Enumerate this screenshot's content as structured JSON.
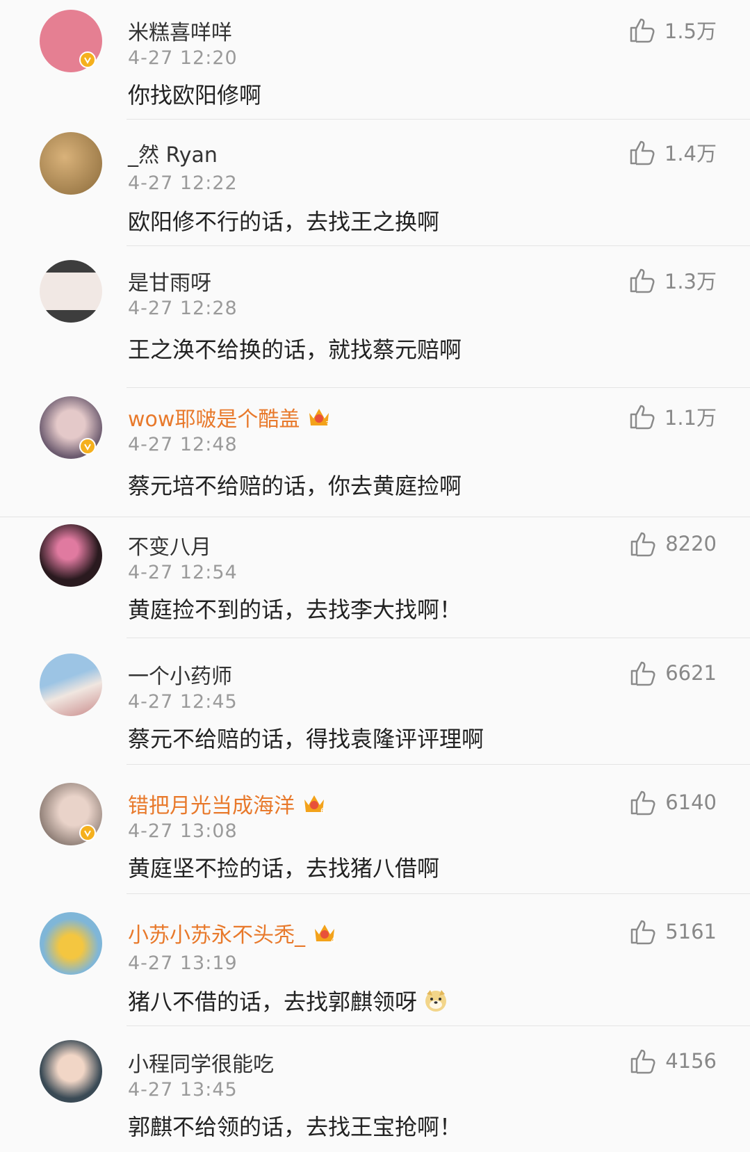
{
  "comments": [
    {
      "name": "米糕喜咩咩",
      "time": "4-27 12:20",
      "text": "你找欧阳修啊",
      "likes": "1.5万",
      "vip": false,
      "verified": true,
      "avatar_color": "#e57f92"
    },
    {
      "name": "_然 Ryan",
      "time": "4-27 12:22",
      "text": "欧阳修不行的话，去找王之换啊",
      "likes": "1.4万",
      "vip": false,
      "verified": false,
      "avatar_color": "#b08a55"
    },
    {
      "name": "是甘雨呀",
      "time": "4-27 12:28",
      "text": "王之涣不给换的话，就找蔡元赔啊",
      "likes": "1.3万",
      "vip": false,
      "verified": false,
      "avatar_color": "#3d3d3d"
    },
    {
      "name": "wow耶啵是个酷盖",
      "time": "4-27 12:48",
      "text": "蔡元培不给赔的话，你去黄庭捡啊",
      "likes": "1.1万",
      "vip": true,
      "crown_level": "3",
      "verified": true,
      "avatar_color": "#6b5a6e"
    },
    {
      "name": "不变八月",
      "time": "4-27 12:54",
      "text": "黄庭捡不到的话，去找李大找啊！",
      "likes": "8220",
      "vip": false,
      "verified": false,
      "avatar_color": "#2a1a1f"
    },
    {
      "name": "一个小药师",
      "time": "4-27 12:45",
      "text": "蔡元不给赔的话，得找袁隆评评理啊",
      "likes": "6621",
      "vip": false,
      "verified": false,
      "avatar_color": "#9cc4e4"
    },
    {
      "name": "错把月光当成海洋",
      "time": "4-27 13:08",
      "text": "黄庭坚不捡的话，去找猪八借啊",
      "likes": "6140",
      "vip": true,
      "crown_level": "6",
      "verified": true,
      "avatar_color": "#8a7a72"
    },
    {
      "name": "小苏小苏永不头秃_",
      "time": "4-27 13:19",
      "text": "猪八不借的话，去找郭麒领呀",
      "likes": "5161",
      "vip": true,
      "crown_level": "4",
      "verified": false,
      "avatar_color": "#7fb6d8"
    },
    {
      "name": "小程同学很能吃",
      "time": "4-27 13:45",
      "text": "郭麒不给领的话，去找王宝抢啊！",
      "likes": "4156",
      "vip": false,
      "verified": false,
      "avatar_color": "#3a4a55"
    }
  ],
  "icons": {
    "like": "thumbs-up-icon",
    "verified": "verified-v-icon",
    "crown": "vip-crown-icon",
    "doge": "doge-emoji-icon"
  },
  "colors": {
    "vip_name": "#e8792b",
    "time": "#9a9a9a",
    "badge": "#f5b01d"
  }
}
